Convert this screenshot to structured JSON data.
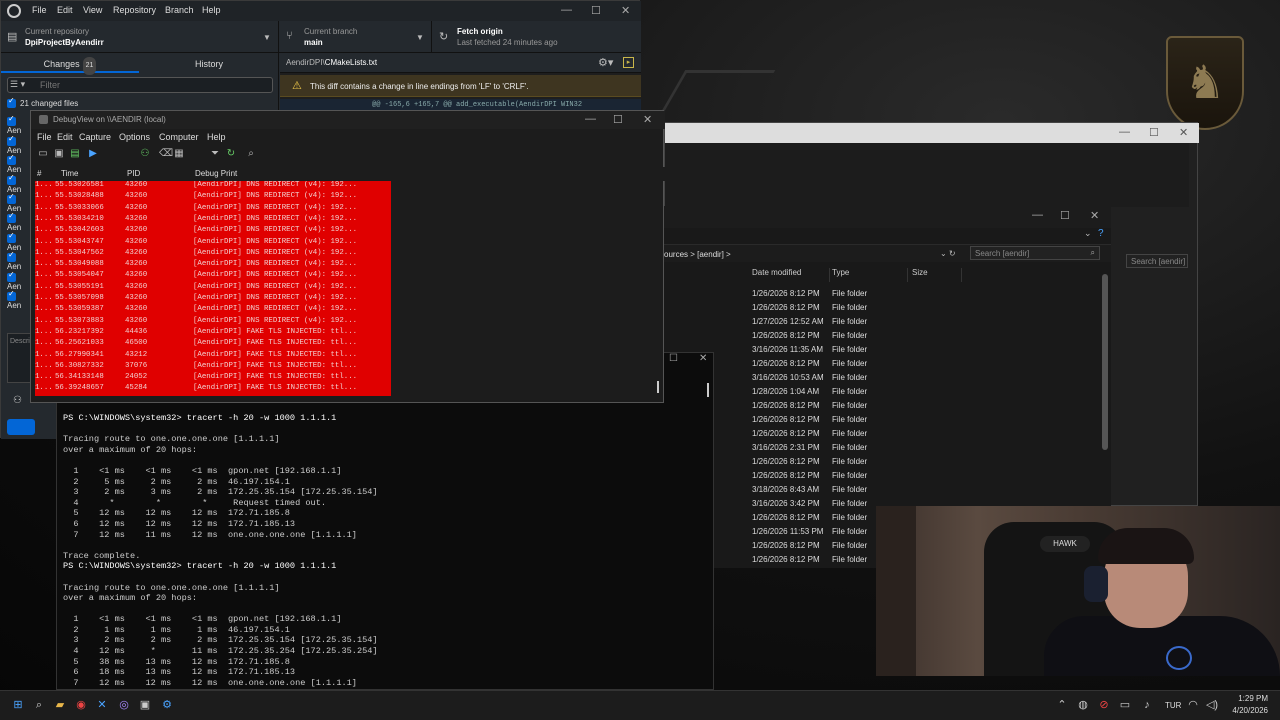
{
  "github": {
    "menu": [
      "File",
      "Edit",
      "View",
      "Repository",
      "Branch",
      "Help"
    ],
    "repo_label": "Current repository",
    "repo_value": "DpiProjectByAendirr",
    "branch_label": "Current branch",
    "branch_value": "main",
    "fetch_label": "Fetch origin",
    "fetch_sub": "Last fetched 24 minutes ago",
    "tab_changes": "Changes",
    "tab_changes_count": "21",
    "tab_history": "History",
    "filter_placeholder": "Filter",
    "changed_files": "21 changed files",
    "file_rows": [
      "Aen",
      "Aen",
      "Aen",
      "Aen",
      "Aen",
      "Aen",
      "Aen",
      "Aen",
      "Aen",
      "Aen"
    ],
    "desc_placeholder": "Descri",
    "diff_path_dir": "AendirDPI\\",
    "diff_path_file": "CMakeLists.txt",
    "diff_warning": "This diff contains a change in line endings from 'LF' to 'CRLF'.",
    "diff_hunk": "@@ -165,6 +165,7 @@ add_executable(AendirDPI WIN32"
  },
  "debugview": {
    "title": "DebugView on \\\\AENDIR (local)",
    "menu": [
      "File",
      "Edit",
      "Capture",
      "Options",
      "Computer",
      "Help"
    ],
    "columns": [
      "#",
      "Time",
      "PID",
      "Debug Print"
    ],
    "rows": [
      {
        "num": "1...",
        "time": "55.53026581",
        "pid": "43260",
        "msg": "[AendirDPI] DNS REDIRECT (v4): 192..."
      },
      {
        "num": "1...",
        "time": "55.53028488",
        "pid": "43260",
        "msg": "[AendirDPI] DNS REDIRECT (v4): 192..."
      },
      {
        "num": "1...",
        "time": "55.53033066",
        "pid": "43260",
        "msg": "[AendirDPI] DNS REDIRECT (v4): 192..."
      },
      {
        "num": "1...",
        "time": "55.53034210",
        "pid": "43260",
        "msg": "[AendirDPI] DNS REDIRECT (v4): 192..."
      },
      {
        "num": "1...",
        "time": "55.53042603",
        "pid": "43260",
        "msg": "[AendirDPI] DNS REDIRECT (v4): 192..."
      },
      {
        "num": "1...",
        "time": "55.53043747",
        "pid": "43260",
        "msg": "[AendirDPI] DNS REDIRECT (v4): 192..."
      },
      {
        "num": "1...",
        "time": "55.53047562",
        "pid": "43260",
        "msg": "[AendirDPI] DNS REDIRECT (v4): 192..."
      },
      {
        "num": "1...",
        "time": "55.53049088",
        "pid": "43260",
        "msg": "[AendirDPI] DNS REDIRECT (v4): 192..."
      },
      {
        "num": "1...",
        "time": "55.53054047",
        "pid": "43260",
        "msg": "[AendirDPI] DNS REDIRECT (v4): 192..."
      },
      {
        "num": "1...",
        "time": "55.53055191",
        "pid": "43260",
        "msg": "[AendirDPI] DNS REDIRECT (v4): 192..."
      },
      {
        "num": "1...",
        "time": "55.53057098",
        "pid": "43260",
        "msg": "[AendirDPI] DNS REDIRECT (v4): 192..."
      },
      {
        "num": "1...",
        "time": "55.53059387",
        "pid": "43260",
        "msg": "[AendirDPI] DNS REDIRECT (v4): 192..."
      },
      {
        "num": "1...",
        "time": "55.53073883",
        "pid": "43260",
        "msg": "[AendirDPI] DNS REDIRECT (v4): 192..."
      },
      {
        "num": "1...",
        "time": "56.23217392",
        "pid": "44436",
        "msg": "[AendirDPI] FAKE TLS INJECTED: ttl..."
      },
      {
        "num": "1...",
        "time": "56.25621033",
        "pid": "46500",
        "msg": "[AendirDPI] FAKE TLS INJECTED: ttl..."
      },
      {
        "num": "1...",
        "time": "56.27990341",
        "pid": "43212",
        "msg": "[AendirDPI] FAKE TLS INJECTED: ttl..."
      },
      {
        "num": "1...",
        "time": "56.30827332",
        "pid": "37076",
        "msg": "[AendirDPI] FAKE TLS INJECTED: ttl..."
      },
      {
        "num": "1...",
        "time": "56.34133148",
        "pid": "24052",
        "msg": "[AendirDPI] FAKE TLS INJECTED: ttl..."
      },
      {
        "num": "1...",
        "time": "56.39248657",
        "pid": "45284",
        "msg": "[AendirDPI] FAKE TLS INJECTED: ttl..."
      }
    ]
  },
  "explorer": {
    "breadcrumb": "ources  >  [aendir]  >",
    "search_placeholder": "Search [aendir]",
    "search_placeholder_back": "Search [aendir]",
    "columns": [
      "Date modified",
      "Type",
      "Size"
    ],
    "rows": [
      {
        "date": "1/26/2026 8:12 PM",
        "type": "File folder"
      },
      {
        "date": "1/26/2026 8:12 PM",
        "type": "File folder"
      },
      {
        "date": "1/27/2026 12:52 AM",
        "type": "File folder"
      },
      {
        "date": "1/26/2026 8:12 PM",
        "type": "File folder"
      },
      {
        "date": "3/16/2026 11:35 AM",
        "type": "File folder"
      },
      {
        "date": "1/26/2026 8:12 PM",
        "type": "File folder"
      },
      {
        "date": "3/16/2026 10:53 AM",
        "type": "File folder"
      },
      {
        "date": "1/28/2026 1:04 AM",
        "type": "File folder"
      },
      {
        "date": "1/26/2026 8:12 PM",
        "type": "File folder"
      },
      {
        "date": "1/26/2026 8:12 PM",
        "type": "File folder"
      },
      {
        "date": "1/26/2026 8:12 PM",
        "type": "File folder"
      },
      {
        "date": "3/16/2026 2:31 PM",
        "type": "File folder"
      },
      {
        "date": "1/26/2026 8:12 PM",
        "type": "File folder"
      },
      {
        "date": "1/26/2026 8:12 PM",
        "type": "File folder"
      },
      {
        "date": "3/18/2026 8:43 AM",
        "type": "File folder"
      },
      {
        "date": "3/16/2026 3:42 PM",
        "type": "File folder"
      },
      {
        "date": "1/26/2026 8:12 PM",
        "type": "File folder"
      },
      {
        "date": "1/26/2026 11:53 PM",
        "type": "File folder"
      },
      {
        "date": "1/26/2026 8:12 PM",
        "type": "File folder"
      },
      {
        "date": "1/26/2026 8:12 PM",
        "type": "File folder"
      }
    ]
  },
  "powershell": {
    "lines": [
      {
        "text": "PS C:\\WINDOWS\\system32> tracert -h 20 -w 1000 1.1.1.1",
        "cmd": true
      },
      {
        "text": "",
        "cmd": false
      },
      {
        "text": "Tracing route to one.one.one.one [1.1.1.1]",
        "cmd": false
      },
      {
        "text": "over a maximum of 20 hops:",
        "cmd": false
      },
      {
        "text": "",
        "cmd": false
      },
      {
        "text": "  1    <1 ms    <1 ms    <1 ms  gpon.net [192.168.1.1]",
        "cmd": false
      },
      {
        "text": "  2     5 ms     2 ms     2 ms  46.197.154.1",
        "cmd": false
      },
      {
        "text": "  3     2 ms     3 ms     2 ms  172.25.35.154 [172.25.35.154]",
        "cmd": false
      },
      {
        "text": "  4      *        *        *     Request timed out.",
        "cmd": false
      },
      {
        "text": "  5    12 ms    12 ms    12 ms  172.71.185.8",
        "cmd": false
      },
      {
        "text": "  6    12 ms    12 ms    12 ms  172.71.185.13",
        "cmd": false
      },
      {
        "text": "  7    12 ms    11 ms    12 ms  one.one.one.one [1.1.1.1]",
        "cmd": false
      },
      {
        "text": "",
        "cmd": false
      },
      {
        "text": "Trace complete.",
        "cmd": false
      },
      {
        "text": "PS C:\\WINDOWS\\system32> tracert -h 20 -w 1000 1.1.1.1",
        "cmd": true
      },
      {
        "text": "",
        "cmd": false
      },
      {
        "text": "Tracing route to one.one.one.one [1.1.1.1]",
        "cmd": false
      },
      {
        "text": "over a maximum of 20 hops:",
        "cmd": false
      },
      {
        "text": "",
        "cmd": false
      },
      {
        "text": "  1    <1 ms    <1 ms    <1 ms  gpon.net [192.168.1.1]",
        "cmd": false
      },
      {
        "text": "  2     1 ms     1 ms     1 ms  46.197.154.1",
        "cmd": false
      },
      {
        "text": "  3     2 ms     2 ms     2 ms  172.25.35.154 [172.25.35.154]",
        "cmd": false
      },
      {
        "text": "  4    12 ms     *       11 ms  172.25.35.254 [172.25.35.254]",
        "cmd": false
      },
      {
        "text": "  5    38 ms    13 ms    12 ms  172.71.185.8",
        "cmd": false
      },
      {
        "text": "  6    18 ms    13 ms    12 ms  172.71.185.13",
        "cmd": false
      },
      {
        "text": "  7    12 ms    12 ms    12 ms  one.one.one.one [1.1.1.1]",
        "cmd": false
      }
    ]
  },
  "webcam": {
    "chair_logo": "HAWK"
  },
  "taskbar": {
    "lang": "TUR",
    "time": "1:29 PM",
    "date": "4/20/2026"
  },
  "colors": {
    "log_bg": "#e00000",
    "accent": "#0366d6",
    "warning": "#f0c94a"
  }
}
